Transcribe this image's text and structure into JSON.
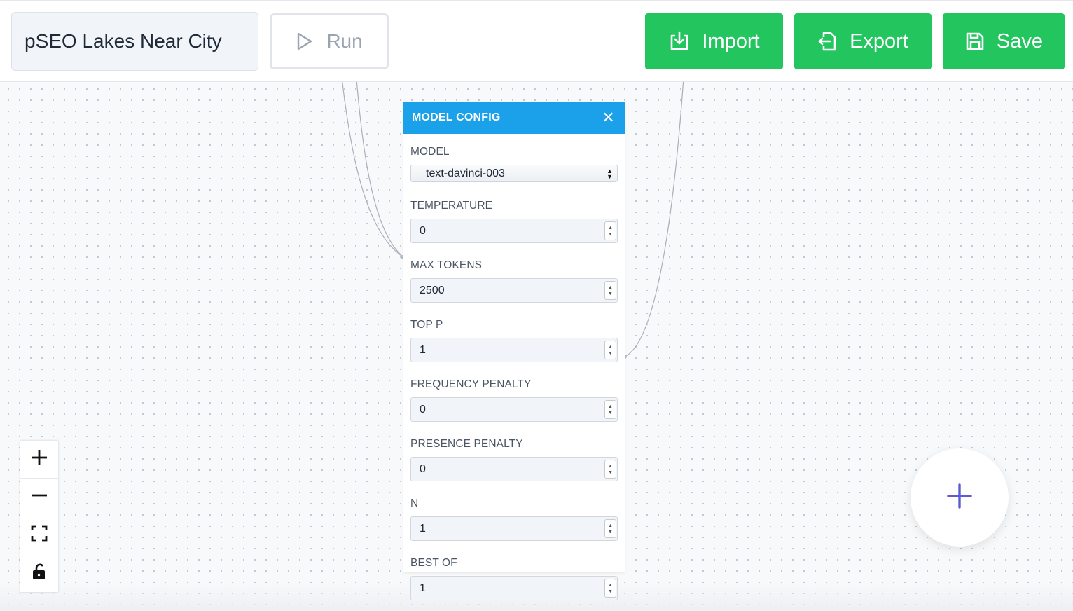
{
  "header": {
    "flow_title": "pSEO Lakes Near City",
    "run_label": "Run",
    "import_label": "Import",
    "export_label": "Export",
    "save_label": "Save"
  },
  "panel": {
    "title": "MODEL CONFIG",
    "close_icon": "close-icon",
    "fields": {
      "model": {
        "label": "MODEL",
        "value": "text-davinci-003"
      },
      "temperature": {
        "label": "TEMPERATURE",
        "value": "0"
      },
      "max_tokens": {
        "label": "MAX TOKENS",
        "value": "2500"
      },
      "top_p": {
        "label": "TOP P",
        "value": "1"
      },
      "frequency_penalty": {
        "label": "FREQUENCY PENALTY",
        "value": "0"
      },
      "presence_penalty": {
        "label": "PRESENCE PENALTY",
        "value": "0"
      },
      "n": {
        "label": "N",
        "value": "1"
      },
      "best_of": {
        "label": "BEST OF",
        "value": "1"
      }
    }
  },
  "controls": {
    "zoom_in_icon": "plus-icon",
    "zoom_out_icon": "minus-icon",
    "fit_view_icon": "fit-view-icon",
    "lock_icon": "unlock-icon",
    "add_node_icon": "plus-icon"
  },
  "colors": {
    "accent_green": "#22c55e",
    "panel_header": "#1ba1e9",
    "fab_plus": "#5b5bd6"
  }
}
